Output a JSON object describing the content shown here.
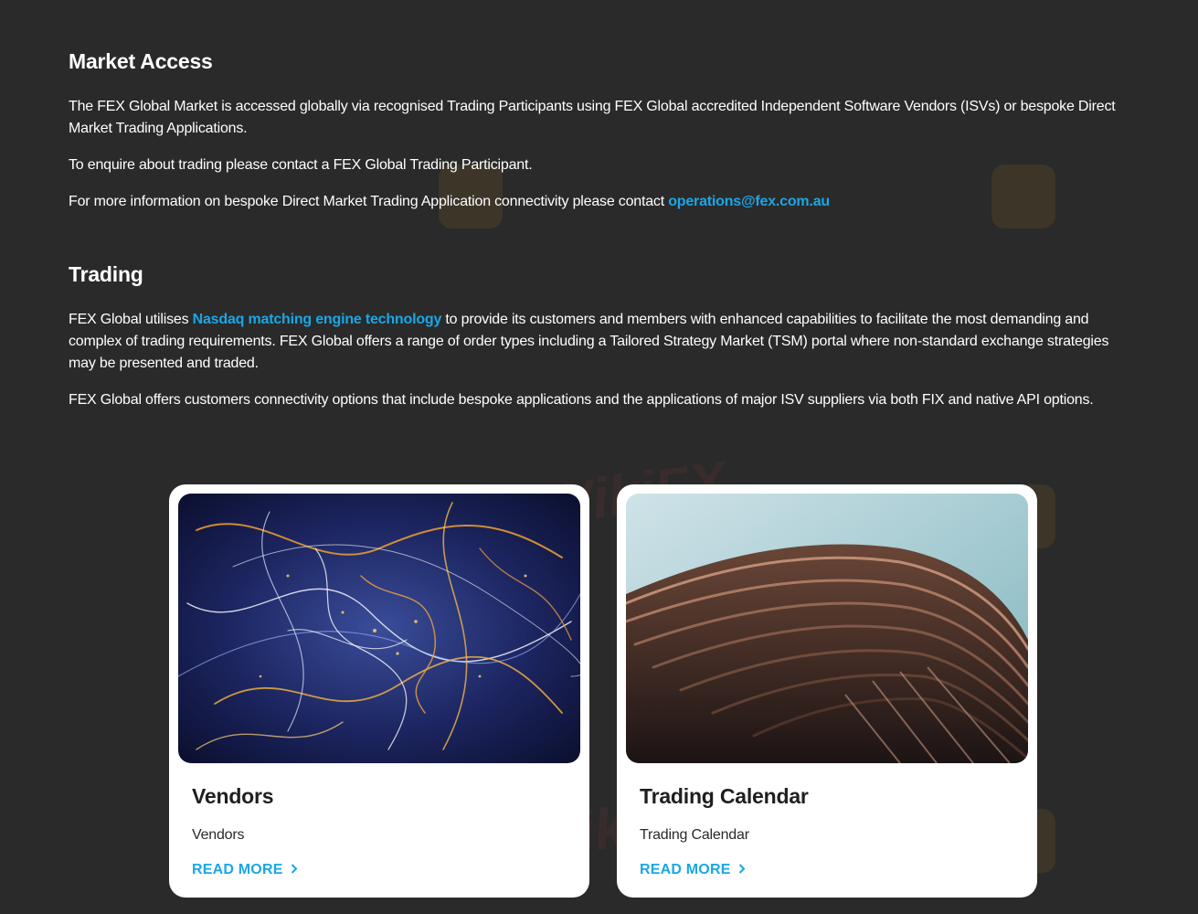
{
  "market_access": {
    "heading": "Market Access",
    "p1": "The FEX Global Market is accessed globally via recognised  Trading Participants using FEX Global accredited Independent Software Vendors (ISVs) or bespoke Direct Market Trading Applications.",
    "p2": "To enquire about trading please contact a FEX Global Trading Participant.",
    "p3_prefix": "For more information on bespoke Direct Market Trading Application connectivity please contact ",
    "p3_email": "operations@fex.com.au"
  },
  "trading": {
    "heading": "Trading",
    "p1_prefix": "FEX Global utilises ",
    "p1_link": "Nasdaq matching engine technology",
    "p1_suffix": " to provide its customers and members with enhanced capabilities to facilitate the most demanding and complex of trading requirements. FEX Global offers a range of order types including a Tailored Strategy Market (TSM) portal where non-standard exchange strategies may be presented and traded.",
    "p2": "FEX Global offers customers connectivity options that include bespoke applications and the applications of major ISV suppliers via both FIX and native API options."
  },
  "cards": [
    {
      "title": "Vendors",
      "subtitle": "Vendors",
      "link": "READ MORE",
      "icon": "chevron-right-icon"
    },
    {
      "title": "Trading Calendar",
      "subtitle": "Trading Calendar",
      "link": "READ MORE",
      "icon": "chevron-right-icon"
    }
  ],
  "watermark": {
    "text": "WikiFX"
  },
  "colors": {
    "background": "#2a2a2a",
    "accent": "#1aa7e6",
    "card": "#ffffff"
  }
}
